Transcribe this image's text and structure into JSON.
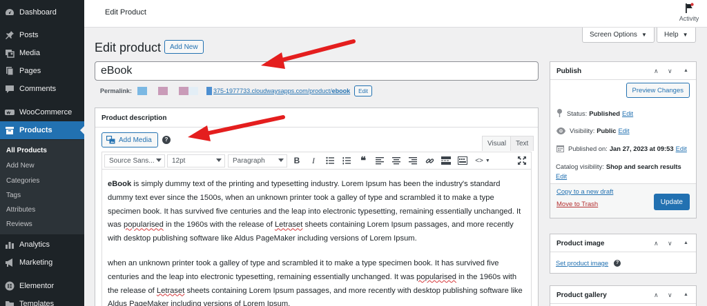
{
  "sidebar": {
    "items": [
      {
        "label": "Dashboard",
        "icon": "dashboard-icon"
      },
      {
        "label": "Posts",
        "icon": "pin-icon"
      },
      {
        "label": "Media",
        "icon": "media-icon"
      },
      {
        "label": "Pages",
        "icon": "pages-icon"
      },
      {
        "label": "Comments",
        "icon": "comment-icon"
      },
      {
        "label": "WooCommerce",
        "icon": "woo-icon"
      },
      {
        "label": "Products",
        "icon": "archive-icon"
      },
      {
        "label": "Analytics",
        "icon": "bar-chart-icon"
      },
      {
        "label": "Marketing",
        "icon": "megaphone-icon"
      },
      {
        "label": "Elementor",
        "icon": "elementor-icon"
      },
      {
        "label": "Templates",
        "icon": "folder-icon"
      }
    ],
    "submenu": [
      "All Products",
      "Add New",
      "Categories",
      "Tags",
      "Attributes",
      "Reviews"
    ]
  },
  "header": {
    "title": "Edit Product",
    "activity": "Activity",
    "screen_options": "Screen Options",
    "help": "Help"
  },
  "page": {
    "heading": "Edit product",
    "add_new": "Add New",
    "product_title": "eBook",
    "permalink_label": "Permalink:",
    "permalink_url": "375-1977733.cloudwaysapps.com/product/",
    "permalink_slug": "ebook",
    "permalink_edit": "Edit"
  },
  "description": {
    "title": "Product description",
    "add_media": "Add Media",
    "tab_visual": "Visual",
    "tab_text": "Text",
    "font_family": "Source Sans...",
    "font_size": "12pt",
    "format": "Paragraph",
    "p1_bold": "eBook",
    "p1_a": " is simply dummy text of the printing and typesetting industry. Lorem Ipsum has been the industry's standard dummy text ever since the 1500s, when an unknown printer took a galley of type and scrambled it to make a type specimen book. It has survived five centuries and the leap into electronic typesetting, remaining essentially unchanged. It was ",
    "p1_w1": "popularised",
    "p1_b": " in the 1960s with the release of ",
    "p1_w2": "Letraset",
    "p1_c": " sheets containing Lorem Ipsum passages, and more recently with desktop publishing software like Aldus PageMaker including versions of Lorem Ipsum.",
    "p2_a": "when an unknown printer took a galley of type and scrambled it to make a type specimen book. It has survived five centuries and the leap into electronic typesetting, remaining essentially unchanged. It was ",
    "p2_w1": "popularised",
    "p2_b": " in the 1960s with the release of ",
    "p2_w2": "Letraset",
    "p2_c": " sheets containing Lorem Ipsum passages, and more recently with desktop publishing software like Aldus PageMaker including versions of Lorem Ipsum."
  },
  "publish": {
    "title": "Publish",
    "preview": "Preview Changes",
    "status_label": "Status:",
    "status_value": "Published",
    "visibility_label": "Visibility:",
    "visibility_value": "Public",
    "published_label": "Published on:",
    "published_value": "Jan 27, 2023 at 09:53",
    "catalog_label": "Catalog visibility:",
    "catalog_value": "Shop and search results",
    "edit": "Edit",
    "copy_draft": "Copy to a new draft",
    "move_trash": "Move to Trash",
    "update": "Update"
  },
  "product_image": {
    "title": "Product image",
    "set_image": "Set product image"
  },
  "product_gallery": {
    "title": "Product gallery"
  },
  "colors": {
    "sidebar_bg": "#1d2327",
    "accent": "#2271b1",
    "trash": "#b32d2e",
    "pixel1": "#7bb8e3",
    "pixel2": "#c99bb8",
    "pixel3": "#c99bb8",
    "pixel4": "#e3eef6",
    "pixel5": "#4d8fd1"
  }
}
